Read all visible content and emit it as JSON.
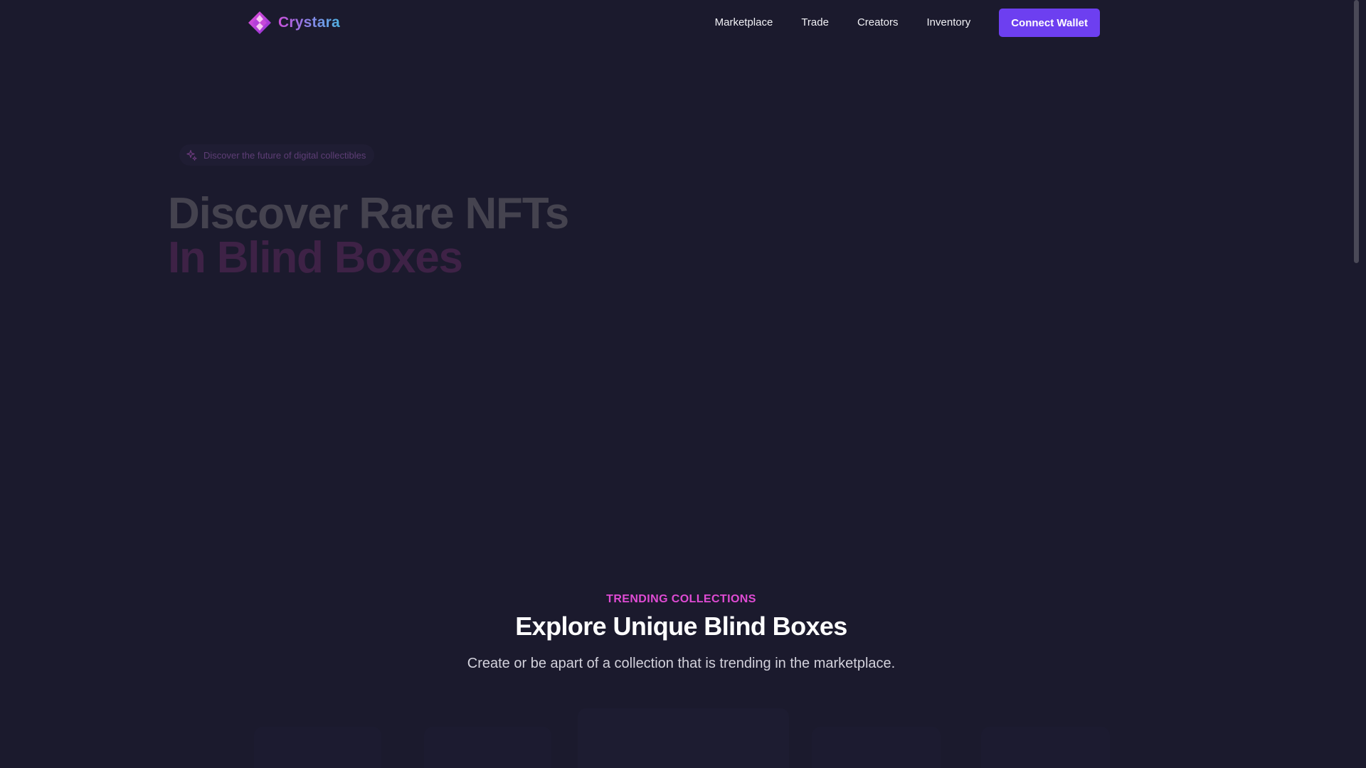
{
  "header": {
    "brand_name": "Crystara",
    "nav": [
      {
        "label": "Marketplace"
      },
      {
        "label": "Trade"
      },
      {
        "label": "Creators"
      },
      {
        "label": "Inventory"
      }
    ],
    "connect_label": "Connect Wallet"
  },
  "hero": {
    "badge_icon": "sparkle-icon",
    "badge_text": "Discover the future of digital collectibles",
    "title_line1": "Discover Rare NFTs",
    "title_line2": "In Blind Boxes"
  },
  "trending": {
    "eyebrow": "TRENDING COLLECTIONS",
    "title": "Explore Unique Blind Boxes",
    "subtitle": "Create or be apart of a collection that is trending in the marketplace."
  },
  "colors": {
    "background": "#1b1a2d",
    "accent": "#6d3ff0",
    "eyebrow": "#e04bd4",
    "brand_gradient_start": "#c84fd8",
    "brand_gradient_end": "#4fb3e3"
  }
}
